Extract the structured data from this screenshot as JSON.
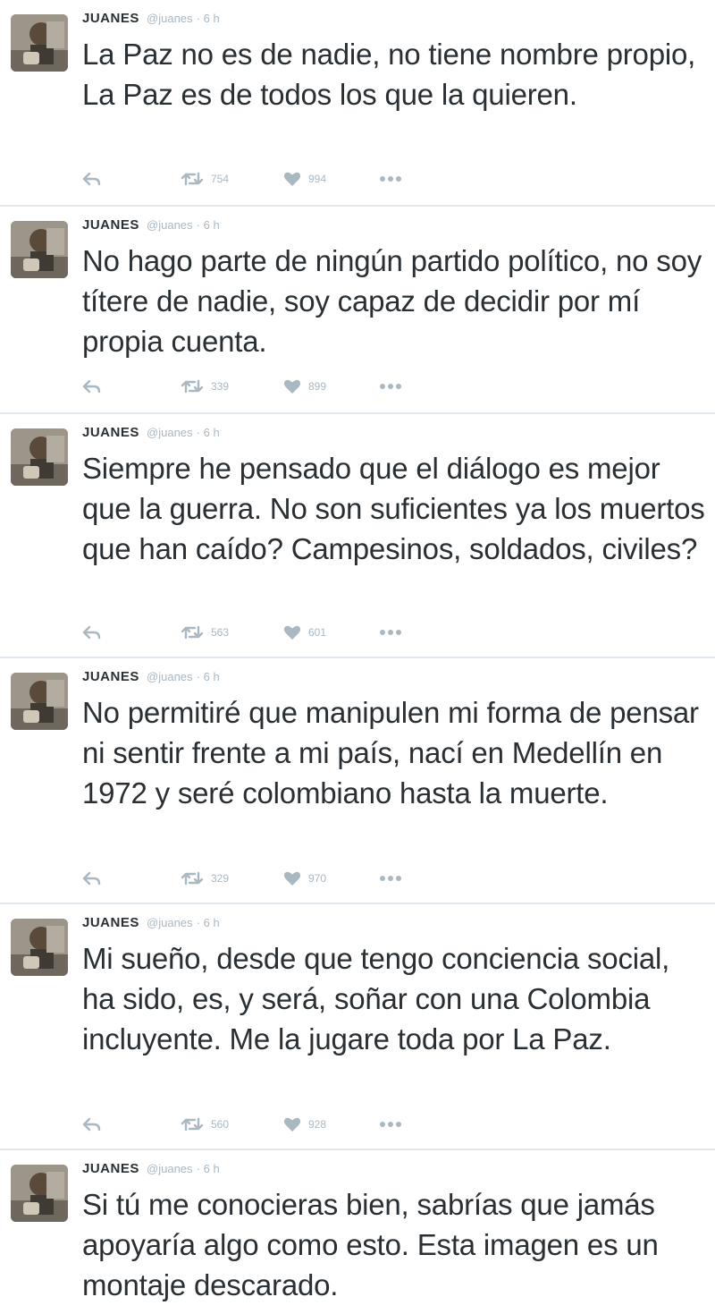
{
  "tweets": [
    {
      "author": "JUANES",
      "handle": "@juanes",
      "time": "· 6 h",
      "text": "La Paz no es de nadie, no tiene nombre propio, La Paz es de todos los que la quieren.",
      "retweets": "754",
      "likes": "994"
    },
    {
      "author": "JUANES",
      "handle": "@juanes",
      "time": "· 6 h",
      "text": "No hago parte de ningún partido político, no soy títere de nadie, soy capaz de decidir por mí propia cuenta.",
      "retweets": "339",
      "likes": "899"
    },
    {
      "author": "JUANES",
      "handle": "@juanes",
      "time": "· 6 h",
      "text": "Siempre he pensado que el diálogo es mejor que la guerra. No son suficientes ya los muertos que han caído? Campesinos, soldados, civiles?",
      "retweets": "563",
      "likes": "601"
    },
    {
      "author": "JUANES",
      "handle": "@juanes",
      "time": "· 6 h",
      "text": "No permitiré que manipulen mi forma de pensar ni sentir frente a mi país, nací en Medellín en 1972 y seré colombiano hasta la muerte.",
      "retweets": "329",
      "likes": "970"
    },
    {
      "author": "JUANES",
      "handle": "@juanes",
      "time": "· 6 h",
      "text": "Mi sueño, desde que tengo conciencia social, ha sido, es, y será, soñar con una Colombia incluyente. Me la jugare toda por La Paz.",
      "retweets": "560",
      "likes": "928"
    },
    {
      "author": "JUANES",
      "handle": "@juanes",
      "time": "· 6 h",
      "text": "Si tú me conocieras bien, sabrías que jamás apoyaría algo como esto. Esta imagen es un montaje descarado."
    }
  ],
  "colors": {
    "text": "#292f33",
    "muted": "#aab8c2",
    "divider": "#e1e8ed"
  },
  "icons": {
    "reply": "reply-icon",
    "retweet": "retweet-icon",
    "like": "heart-icon",
    "more": "more-icon",
    "avatar": "avatar"
  }
}
